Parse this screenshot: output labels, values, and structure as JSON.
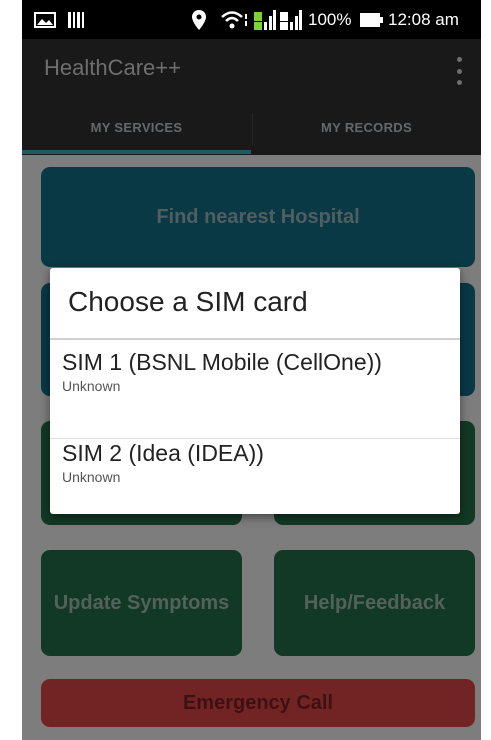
{
  "status_bar": {
    "battery_percent": "100%",
    "time": "12:08 am",
    "icons": [
      "image-icon",
      "barcode-icon",
      "location-icon",
      "wifi-icon",
      "signal-sim1-icon",
      "signal-sim2-icon",
      "battery-icon"
    ]
  },
  "app": {
    "title": "HealthCare++",
    "overflow_icon": "more-vert-icon"
  },
  "tabs": [
    {
      "label": "MY SERVICES",
      "selected": true
    },
    {
      "label": "MY RECORDS",
      "selected": false
    }
  ],
  "tiles": {
    "find_hospital": "Find nearest Hospital",
    "update_symptoms": "Update Symptoms",
    "help_feedback": "Help/Feedback",
    "emergency_call": "Emergency Call"
  },
  "dialog": {
    "title": "Choose a SIM card",
    "options": [
      {
        "name": "SIM 1 (BSNL Mobile (CellOne))",
        "status": "Unknown"
      },
      {
        "name": "SIM 2 (Idea (IDEA))",
        "status": "Unknown"
      }
    ]
  },
  "colors": {
    "accent_teal": "#3a9ea8",
    "tile_blue": "#0f6275",
    "tile_green": "#1f6240",
    "tile_red": "#c53f3f",
    "appbar": "#2c2c2c"
  }
}
